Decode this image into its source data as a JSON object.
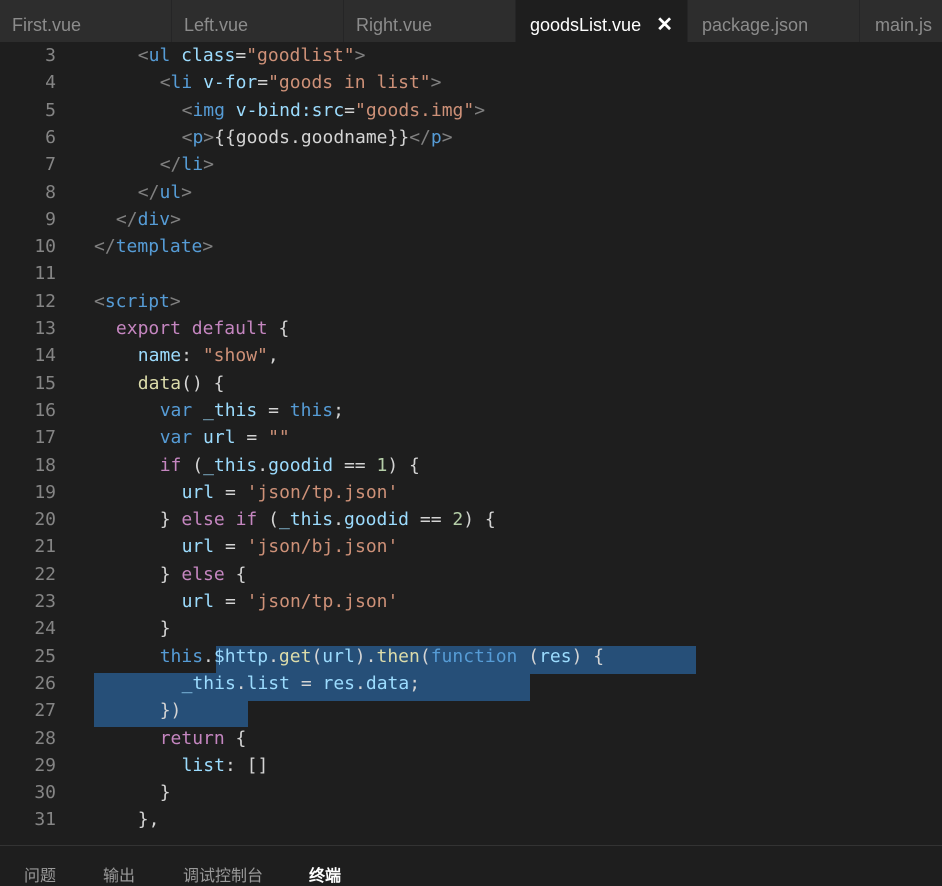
{
  "tabs": [
    {
      "label": "First.vue",
      "active": false
    },
    {
      "label": "Left.vue",
      "active": false
    },
    {
      "label": "Right.vue",
      "active": false
    },
    {
      "label": "goodsList.vue",
      "active": true,
      "close": "✕"
    },
    {
      "label": "package.json",
      "active": false
    },
    {
      "label": "main.js",
      "active": false
    }
  ],
  "colors": {
    "tag": "#569cd6",
    "bracket": "#808080",
    "attr": "#9cdcfe",
    "string": "#ce9178",
    "keyword": "#c586c0",
    "var": "#569cd6",
    "func": "#dcdcaa",
    "number": "#b5cea8",
    "text": "#d4d4d4",
    "prop": "#9cdcfe",
    "selection": "#264f78"
  },
  "code_lines": [
    {
      "n": "3",
      "ind": 4,
      "t": [
        [
          "b",
          "<"
        ],
        [
          "tag",
          "ul"
        ],
        [
          "x",
          " "
        ],
        [
          "attr",
          "class"
        ],
        [
          "x",
          "="
        ],
        [
          "str",
          "\"goodlist\""
        ],
        [
          "b",
          ">"
        ]
      ]
    },
    {
      "n": "4",
      "ind": 6,
      "t": [
        [
          "b",
          "<"
        ],
        [
          "tag",
          "li"
        ],
        [
          "x",
          " "
        ],
        [
          "attr",
          "v-for"
        ],
        [
          "x",
          "="
        ],
        [
          "str",
          "\"goods in list\""
        ],
        [
          "b",
          ">"
        ]
      ]
    },
    {
      "n": "5",
      "ind": 8,
      "t": [
        [
          "b",
          "<"
        ],
        [
          "tag",
          "img"
        ],
        [
          "x",
          " "
        ],
        [
          "attr",
          "v-bind:src"
        ],
        [
          "x",
          "="
        ],
        [
          "str",
          "\"goods.img\""
        ],
        [
          "b",
          ">"
        ]
      ]
    },
    {
      "n": "6",
      "ind": 8,
      "t": [
        [
          "b",
          "<"
        ],
        [
          "tag",
          "p"
        ],
        [
          "b",
          ">"
        ],
        [
          "x",
          "{{goods.goodname}}"
        ],
        [
          "b",
          "</"
        ],
        [
          "tag",
          "p"
        ],
        [
          "b",
          ">"
        ]
      ]
    },
    {
      "n": "7",
      "ind": 6,
      "t": [
        [
          "b",
          "</"
        ],
        [
          "tag",
          "li"
        ],
        [
          "b",
          ">"
        ]
      ]
    },
    {
      "n": "8",
      "ind": 4,
      "t": [
        [
          "b",
          "</"
        ],
        [
          "tag",
          "ul"
        ],
        [
          "b",
          ">"
        ]
      ]
    },
    {
      "n": "9",
      "ind": 2,
      "t": [
        [
          "b",
          "</"
        ],
        [
          "tag",
          "div"
        ],
        [
          "b",
          ">"
        ]
      ]
    },
    {
      "n": "10",
      "ind": 0,
      "t": [
        [
          "b",
          "</"
        ],
        [
          "tag",
          "template"
        ],
        [
          "b",
          ">"
        ]
      ]
    },
    {
      "n": "11",
      "ind": 0,
      "t": []
    },
    {
      "n": "12",
      "ind": 0,
      "t": [
        [
          "b",
          "<"
        ],
        [
          "tag",
          "script"
        ],
        [
          "b",
          ">"
        ]
      ]
    },
    {
      "n": "13",
      "ind": 2,
      "t": [
        [
          "kw",
          "export"
        ],
        [
          "x",
          " "
        ],
        [
          "kw",
          "default"
        ],
        [
          "x",
          " {"
        ]
      ]
    },
    {
      "n": "14",
      "ind": 4,
      "t": [
        [
          "prop",
          "name"
        ],
        [
          "x",
          ": "
        ],
        [
          "str",
          "\"show\""
        ],
        [
          "x",
          ","
        ]
      ]
    },
    {
      "n": "15",
      "ind": 4,
      "t": [
        [
          "fn",
          "data"
        ],
        [
          "x",
          "() {"
        ]
      ]
    },
    {
      "n": "16",
      "ind": 6,
      "t": [
        [
          "var",
          "var"
        ],
        [
          "x",
          " "
        ],
        [
          "prop",
          "_this"
        ],
        [
          "x",
          " = "
        ],
        [
          "var",
          "this"
        ],
        [
          "x",
          ";"
        ]
      ]
    },
    {
      "n": "17",
      "ind": 6,
      "t": [
        [
          "var",
          "var"
        ],
        [
          "x",
          " "
        ],
        [
          "prop",
          "url"
        ],
        [
          "x",
          " = "
        ],
        [
          "str",
          "\"\""
        ]
      ]
    },
    {
      "n": "18",
      "ind": 6,
      "t": [
        [
          "kw",
          "if"
        ],
        [
          "x",
          " ("
        ],
        [
          "prop",
          "_this"
        ],
        [
          "x",
          "."
        ],
        [
          "prop",
          "goodid"
        ],
        [
          "x",
          " == "
        ],
        [
          "num",
          "1"
        ],
        [
          "x",
          ") {"
        ]
      ]
    },
    {
      "n": "19",
      "ind": 8,
      "t": [
        [
          "prop",
          "url"
        ],
        [
          "x",
          " = "
        ],
        [
          "str",
          "'json/tp.json'"
        ]
      ]
    },
    {
      "n": "20",
      "ind": 6,
      "t": [
        [
          "x",
          "} "
        ],
        [
          "kw",
          "else"
        ],
        [
          "x",
          " "
        ],
        [
          "kw",
          "if"
        ],
        [
          "x",
          " ("
        ],
        [
          "prop",
          "_this"
        ],
        [
          "x",
          "."
        ],
        [
          "prop",
          "goodid"
        ],
        [
          "x",
          " == "
        ],
        [
          "num",
          "2"
        ],
        [
          "x",
          ") {"
        ]
      ]
    },
    {
      "n": "21",
      "ind": 8,
      "t": [
        [
          "prop",
          "url"
        ],
        [
          "x",
          " = "
        ],
        [
          "str",
          "'json/bj.json'"
        ]
      ]
    },
    {
      "n": "22",
      "ind": 6,
      "t": [
        [
          "x",
          "} "
        ],
        [
          "kw",
          "else"
        ],
        [
          "x",
          " {"
        ]
      ]
    },
    {
      "n": "23",
      "ind": 8,
      "t": [
        [
          "prop",
          "url"
        ],
        [
          "x",
          " = "
        ],
        [
          "str",
          "'json/tp.json'"
        ]
      ]
    },
    {
      "n": "24",
      "ind": 6,
      "t": [
        [
          "x",
          "}"
        ]
      ]
    },
    {
      "n": "25",
      "ind": 6,
      "t": [
        [
          "var",
          "this"
        ],
        [
          "x",
          "."
        ],
        [
          "prop",
          "$http"
        ],
        [
          "x",
          "."
        ],
        [
          "fn",
          "get"
        ],
        [
          "x",
          "("
        ],
        [
          "prop",
          "url"
        ],
        [
          "x",
          ")."
        ],
        [
          "fn",
          "then"
        ],
        [
          "x",
          "("
        ],
        [
          "var",
          "function"
        ],
        [
          "x",
          " ("
        ],
        [
          "prop",
          "res"
        ],
        [
          "x",
          ") {"
        ]
      ]
    },
    {
      "n": "26",
      "ind": 8,
      "t": [
        [
          "prop",
          "_this"
        ],
        [
          "x",
          "."
        ],
        [
          "prop",
          "list"
        ],
        [
          "x",
          " = "
        ],
        [
          "prop",
          "res"
        ],
        [
          "x",
          "."
        ],
        [
          "prop",
          "data"
        ],
        [
          "x",
          ";"
        ]
      ]
    },
    {
      "n": "27",
      "ind": 6,
      "t": [
        [
          "x",
          "})"
        ]
      ]
    },
    {
      "n": "28",
      "ind": 6,
      "t": [
        [
          "kw",
          "return"
        ],
        [
          "x",
          " {"
        ]
      ]
    },
    {
      "n": "29",
      "ind": 8,
      "t": [
        [
          "prop",
          "list"
        ],
        [
          "x",
          ": []"
        ]
      ]
    },
    {
      "n": "30",
      "ind": 6,
      "t": [
        [
          "x",
          "}"
        ]
      ]
    },
    {
      "n": "31",
      "ind": 4,
      "t": [
        [
          "x",
          "},"
        ]
      ]
    }
  ],
  "panel": {
    "tabs": [
      {
        "label": "问题",
        "active": false
      },
      {
        "label": "输出",
        "active": false
      },
      {
        "label": "调试控制台",
        "active": false
      },
      {
        "label": "终端",
        "active": true
      }
    ]
  }
}
